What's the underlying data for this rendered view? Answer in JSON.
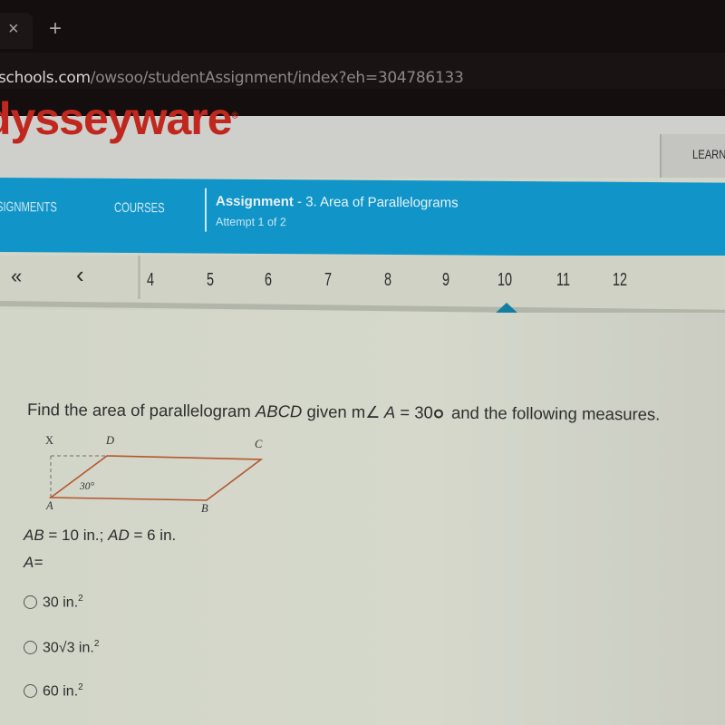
{
  "browser": {
    "tab_close_icon": "close-icon",
    "new_tab_icon": "plus-icon",
    "url_host": "schools.com",
    "url_path": "/owsoo/studentAssignment/index?eh=304786133"
  },
  "header": {
    "logo_text": "dysseyware",
    "logo_mark": "®",
    "learn_label": "LEARN"
  },
  "nav": {
    "items": [
      {
        "label": "SIGNMENTS"
      },
      {
        "label": "COURSES"
      }
    ],
    "assignment_label": "Assignment",
    "assignment_title": " - 3. Area of Parallelograms",
    "attempt": "Attempt 1 of 2"
  },
  "question_nav": {
    "first_icon": "«",
    "prev_icon": "‹",
    "numbers": [
      "4",
      "5",
      "6",
      "7",
      "8",
      "9",
      "10",
      "11",
      "12"
    ],
    "active": "10",
    "accent_color": "#137fa0"
  },
  "question": {
    "prompt_pre": "Find the area of parallelogram ",
    "prompt_shape": "ABCD",
    "prompt_mid": " given m",
    "angle_symbol": "∠",
    "prompt_vertex": " A",
    "prompt_eq": " = 30",
    "prompt_post": " and the following measures.",
    "figure": {
      "labels": {
        "X": "X",
        "D": "D",
        "C": "C",
        "A": "A",
        "B": "B"
      },
      "angle_label": "30°",
      "line_color": "#b5562f"
    },
    "measures_ab": "AB",
    "measures_ab_val": " = 10 in.; ",
    "measures_ad": "AD",
    "measures_ad_val": " = 6 in.",
    "area_label": "A=",
    "options": [
      {
        "text": "30 in.",
        "sup": "2"
      },
      {
        "text": "30√3 in.",
        "sup": "2"
      },
      {
        "text": "60 in.",
        "sup": "2"
      }
    ]
  }
}
